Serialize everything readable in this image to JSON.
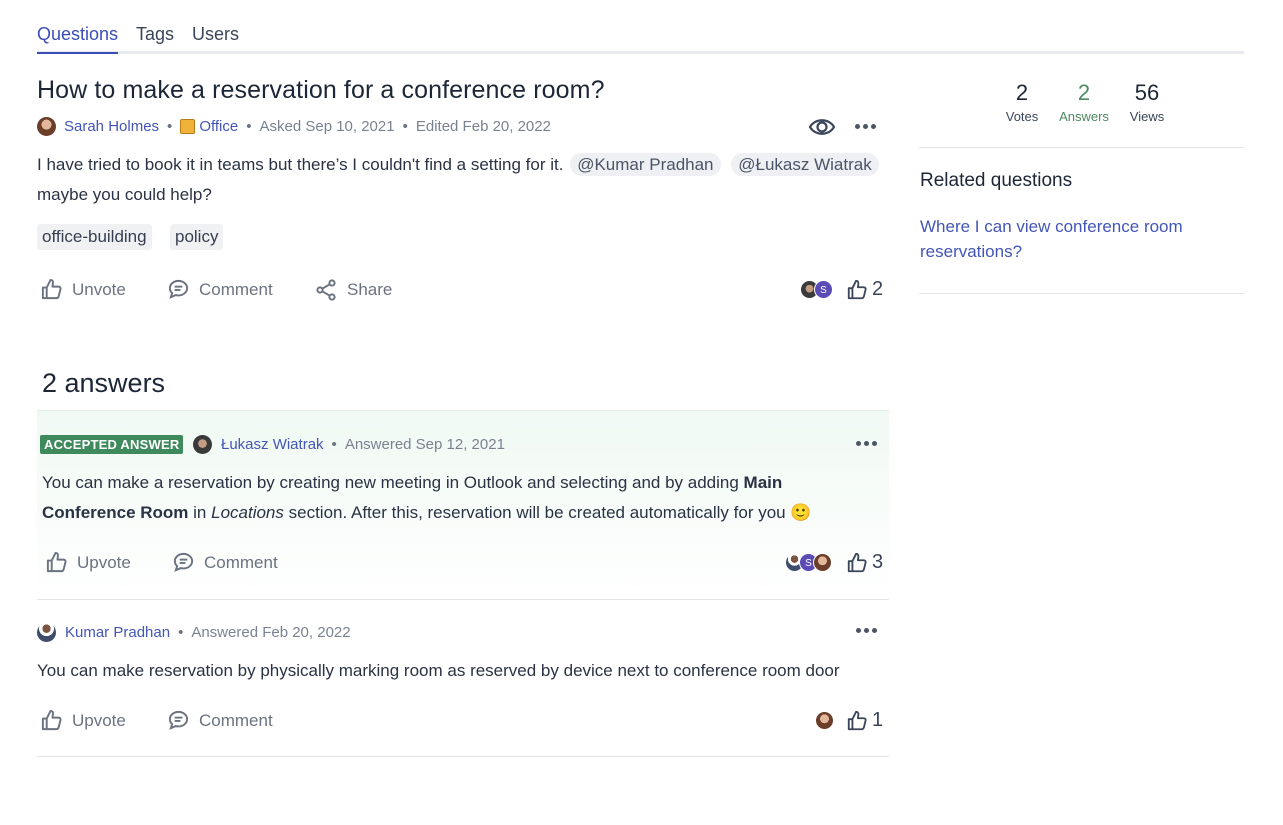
{
  "tabs": [
    "Questions",
    "Tags",
    "Users"
  ],
  "question": {
    "title": "How to make a reservation for a conference room?",
    "author": "Sarah Holmes",
    "space": "Office",
    "asked": "Asked Sep 10, 2021",
    "edited": "Edited Feb 20, 2022",
    "body_text": "I have tried to book it in teams but there’s I couldn't find a setting for it.",
    "mention1": "@Kumar Pradhan",
    "mention2": "@Łukasz Wiatrak",
    "body_tail": "maybe you could help?",
    "tags": [
      "office-building",
      "policy"
    ],
    "actions": {
      "unvote": "Unvote",
      "comment": "Comment",
      "share": "Share"
    },
    "votes": "2"
  },
  "answers_heading": "2 answers",
  "answers": [
    {
      "badge": "ACCEPTED ANSWER",
      "author": "Łukasz Wiatrak",
      "answered": "Answered Sep 12, 2021",
      "text1": "You can make a reservation by creating new meeting in Outlook and selecting and by adding ",
      "bold1": "Main",
      "bold2": "Conference Room",
      "text2": " in ",
      "italic": "Locations",
      "text3": " section. After this, reservation will be created automatically for you ",
      "emoji": "🙂",
      "upvote": "Upvote",
      "comment": "Comment",
      "votes": "3"
    },
    {
      "author": "Kumar Pradhan",
      "answered": "Answered Feb 20, 2022",
      "text": "You can make reservation by physically marking room as reserved by device next to conference room door",
      "upvote": "Upvote",
      "comment": "Comment",
      "votes": "1"
    }
  ],
  "stats": [
    {
      "value": "2",
      "label": "Votes"
    },
    {
      "value": "2",
      "label": "Answers"
    },
    {
      "value": "56",
      "label": "Views"
    }
  ],
  "related": {
    "title": "Related questions",
    "link": "Where I can view conference room reservations?"
  },
  "colors": {
    "accent": "#3b4db6",
    "accepted": "#3f8a5d"
  },
  "voter_initial": "S"
}
